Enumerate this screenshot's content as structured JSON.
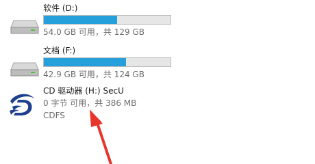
{
  "drives": [
    {
      "name": "软件 (D:)",
      "info": "54.0 GB 可用，共 129 GB",
      "used_fraction": 0.58,
      "icon": "hard-drive-icon"
    },
    {
      "name": "文档 (F:)",
      "info": "42.9 GB 可用，共 124 GB",
      "used_fraction": 0.65,
      "icon": "hard-drive-icon"
    }
  ],
  "cd_drive": {
    "name": "CD 驱动器 (H:) SecU",
    "info": "0 字节 可用，共 386 MB",
    "filesystem": "CDFS",
    "icon": "secu-logo-icon"
  },
  "colors": {
    "bar_fill": "#26a0da",
    "bar_track": "#e6e6e6",
    "annotation_arrow": "#e8352b",
    "cd_logo": "#1f3f8f"
  }
}
